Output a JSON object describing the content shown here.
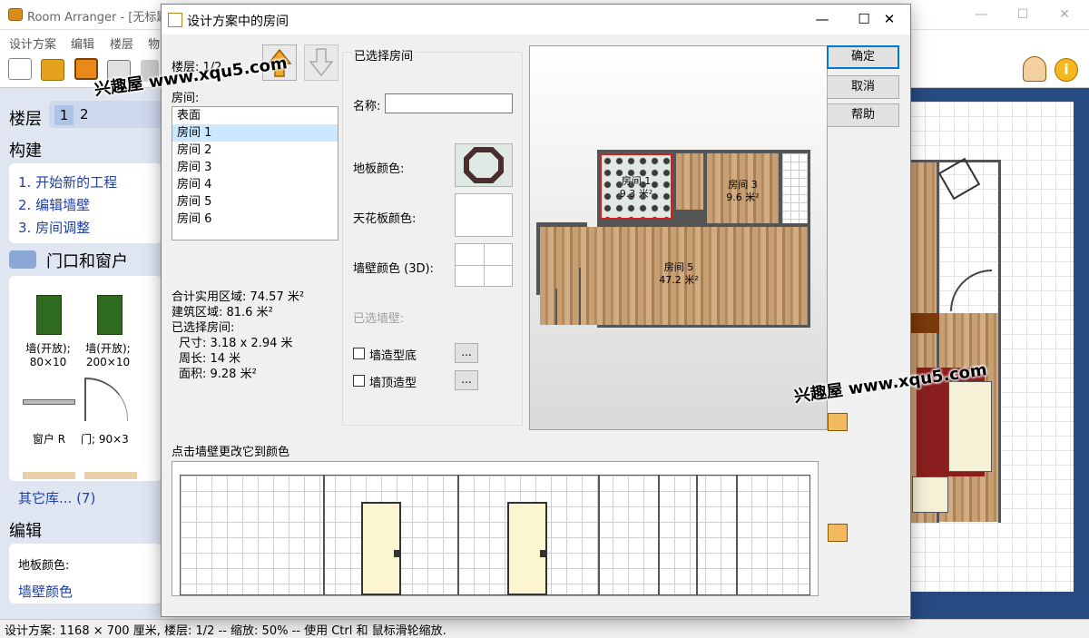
{
  "app": {
    "title": "Room Arranger - [无标题",
    "menu": [
      "设计方案",
      "编辑",
      "楼层",
      "物"
    ],
    "toolbar_icons": [
      "new-icon",
      "open-icon",
      "save-icon",
      "print-icon",
      "undo-icon"
    ],
    "right_icons": [
      "pointer-hand-icon",
      "info-icon"
    ]
  },
  "left_panel": {
    "floors_title": "楼层",
    "floor_tabs": [
      "1",
      "2"
    ],
    "build_title": "构建",
    "steps": [
      "1. 开始新的工程",
      "2. 编辑墙壁",
      "3. 房间调整"
    ],
    "doors_title": "门口和窗户",
    "objects": [
      {
        "label": "墙(开放);\n80×10"
      },
      {
        "label": "墙(开放);\n200×10"
      },
      {
        "label": "窗户 R"
      },
      {
        "label": "门; 90×3"
      }
    ],
    "more_library": "其它库... (7)",
    "edit_title": "编辑",
    "floor_color_label": "地板颜色:",
    "wall_color_link": "墙壁颜色"
  },
  "status_bar": {
    "text": "设计方案: 1168 × 700 厘米, 楼层: 1/2 -- 缩放: 50% -- 使用 Ctrl 和 鼠标滑轮缩放."
  },
  "dialog": {
    "title": "设计方案中的房间",
    "floor_label": "楼层: 1/2",
    "rooms_label": "房间:",
    "rooms": [
      "表面",
      "房间 1",
      "房间 2",
      "房间 3",
      "房间 4",
      "房间 5",
      "房间 6"
    ],
    "selected_room_index": 1,
    "stats": {
      "total_area": "合计实用区域: 74.57 米²",
      "build_area": "建筑区域: 81.6 米²",
      "selected_room": "已选择房间:",
      "size": "尺寸: 3.18 x 2.94 米",
      "perimeter": "周长: 14 米",
      "area": "面积: 9.28 米²"
    },
    "group_title": "已选择房间",
    "name_label": "名称:",
    "name_value": "",
    "floor_color_label": "地板颜色:",
    "ceiling_color_label": "天花板颜色:",
    "wall_color_label": "墙壁颜色 (3D):",
    "selected_wall_label": "已选墙壁:",
    "checkbox_base": "墙造型底",
    "checkbox_top": "墙顶造型",
    "more_label": "...",
    "buttons": {
      "ok": "确定",
      "cancel": "取消",
      "help": "帮助"
    },
    "wall_strip_label": "点击墙壁更改它到颜色",
    "plan_rooms": [
      {
        "name": "房间 1",
        "area": "9.3 米²"
      },
      {
        "name": "房间 3",
        "area": "9.6 米²"
      },
      {
        "name": "房间 5",
        "area": "47.2 米²"
      }
    ]
  },
  "watermark": "兴趣屋 www.xqu5.com",
  "colors": {
    "selection": "#cce8ff",
    "link_blue": "#2040a8",
    "panel_bg": "#dfe6f2",
    "canvas_bg": "#274a82"
  }
}
